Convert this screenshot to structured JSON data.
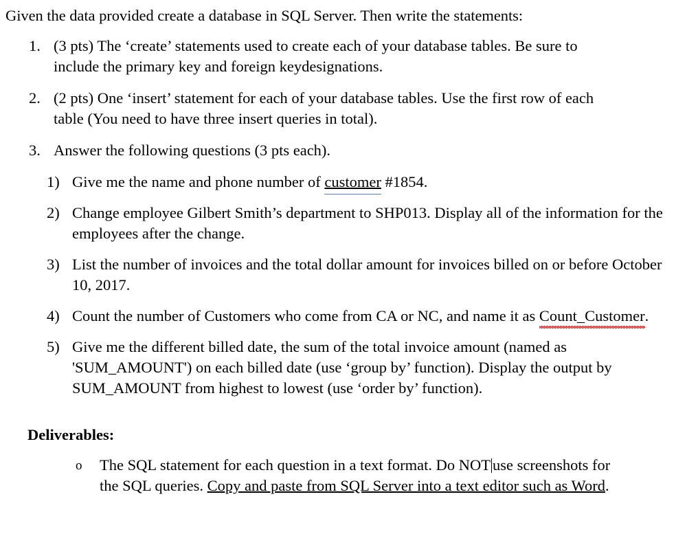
{
  "document": {
    "intro": "Given the data provided create a database in SQL Server. Then write the statements:",
    "main_list": [
      {
        "marker": "1.",
        "text": "(3 pts) The ‘create’ statements used to create each of your database tables. Be sure to include the primary key and foreign keydesignations."
      },
      {
        "marker": "2.",
        "text": "(2 pts) One ‘insert’ statement for each of your database tables. Use the first row of each table (You need to have three insert queries in total)."
      },
      {
        "marker": "3.",
        "text": "Answer the following questions (3 pts each)."
      }
    ],
    "questions": [
      {
        "marker": "1)",
        "parts": [
          {
            "type": "text",
            "value": "Give me the name and phone number of "
          },
          {
            "type": "spell-blue",
            "value": "customer"
          },
          {
            "type": "text",
            "value": " #1854."
          }
        ],
        "plain": "Give me the name and phone number of customer #1854."
      },
      {
        "marker": "2)",
        "parts": [
          {
            "type": "text",
            "value": "Change employee Gilbert Smith’s department to SHP013. Display all of the information for the employees after the change."
          }
        ],
        "plain": "Change employee Gilbert Smith’s department to SHP013. Display all of the information for the employees after the change."
      },
      {
        "marker": "3)",
        "parts": [
          {
            "type": "text",
            "value": "List the number of invoices and the total dollar amount for invoices billed on or before October 10, 2017."
          }
        ],
        "plain": "List the number of invoices and the total dollar amount for invoices billed on or before October 10, 2017."
      },
      {
        "marker": "4)",
        "parts": [
          {
            "type": "text",
            "value": "Count the number of Customers who come from CA or NC, and name it as "
          },
          {
            "type": "spell-red",
            "value": "Count_Customer"
          },
          {
            "type": "text",
            "value": "."
          }
        ],
        "plain": "Count the number of Customers who come from CA or NC, and name it as Count_Customer."
      },
      {
        "marker": "5)",
        "parts": [
          {
            "type": "text",
            "value": "Give me the different billed date, the sum of the total invoice amount (named as 'SUM_AMOUNT') on each billed date (use ‘group by’ function). Display the output by SUM_AMOUNT from highest to lowest (use ‘order by’ function)."
          }
        ],
        "plain": "Give me the different billed date, the sum of the total invoice amount (named as 'SUM_AMOUNT') on each billed date (use ‘group by’ function). Display the output by SUM_AMOUNT from highest to lowest (use ‘order by’ function)."
      }
    ],
    "deliverables": {
      "heading": "Deliverables:",
      "bullet_glyph": "o",
      "item": {
        "segment_1": "The SQL statement for each question in a text format. Do NOT",
        "caret_after": "NOT",
        "segment_2": "use screenshots for the SQL queries. ",
        "segment_underlined": "Copy and paste from SQL Server into a text editor such as Word",
        "segment_3": "."
      }
    }
  },
  "colors": {
    "text": "#000000",
    "background": "#ffffff",
    "spell_error_red": "#d43a3a",
    "grammar_blue": "#5b7fa6"
  }
}
